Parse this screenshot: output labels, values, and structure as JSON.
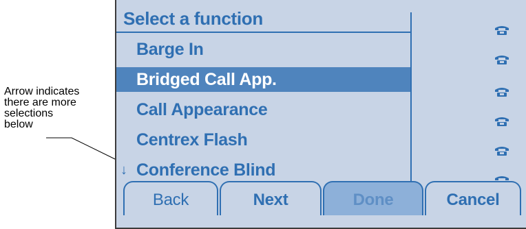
{
  "annotation": "Arrow indicates\nthere are more\nselections\nbelow",
  "screen": {
    "title": "Select a function",
    "menu_items": [
      {
        "label": "Barge In",
        "selected": false,
        "arrow": ""
      },
      {
        "label": "Bridged Call App.",
        "selected": true,
        "arrow": ""
      },
      {
        "label": "Call Appearance",
        "selected": false,
        "arrow": ""
      },
      {
        "label": "Centrex Flash",
        "selected": false,
        "arrow": ""
      },
      {
        "label": "Conference Blind",
        "selected": false,
        "arrow": "↓"
      }
    ],
    "line_icons": [
      "phone-icon",
      "phone-icon",
      "phone-icon",
      "phone-icon",
      "phone-icon",
      "phone-icon"
    ],
    "softkeys": {
      "back": "Back",
      "next": "Next",
      "done": "Done",
      "cancel": "Cancel"
    }
  },
  "colors": {
    "screen_bg": "#c8d4e6",
    "text_blue": "#2f6fb2",
    "selected_bg": "#4f84bd",
    "disabled_tab_bg": "#8db0d9"
  }
}
